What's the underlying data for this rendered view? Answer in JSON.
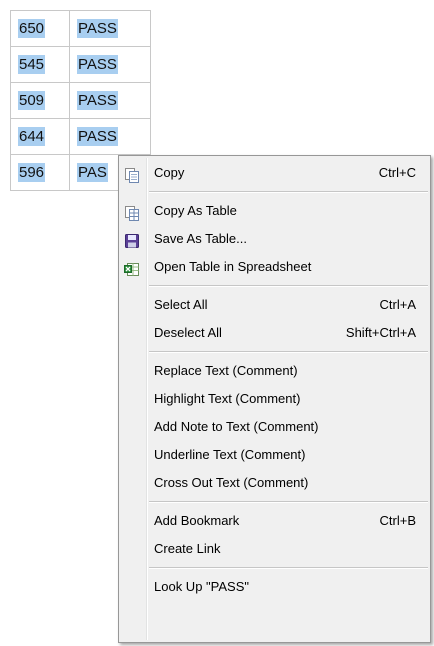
{
  "table": {
    "rows": [
      {
        "id": "650",
        "status": "PASS"
      },
      {
        "id": "545",
        "status": "PASS"
      },
      {
        "id": "509",
        "status": "PASS"
      },
      {
        "id": "644",
        "status": "PASS"
      },
      {
        "id": "596",
        "status": "PAS"
      }
    ],
    "selection_color": "#a8cef0"
  },
  "menu": {
    "copy": {
      "label": "Copy",
      "shortcut": "Ctrl+C",
      "icon": "copy-icon"
    },
    "copy_as_table": {
      "label": "Copy As Table",
      "icon": "copy-table-icon"
    },
    "save_as_table": {
      "label": "Save As Table...",
      "icon": "save-disk-icon"
    },
    "open_table_spreadsheet": {
      "label": "Open Table in Spreadsheet",
      "icon": "spreadsheet-icon"
    },
    "select_all": {
      "label": "Select All",
      "shortcut": "Ctrl+A"
    },
    "deselect_all": {
      "label": "Deselect All",
      "shortcut": "Shift+Ctrl+A"
    },
    "replace_text": {
      "label": "Replace Text (Comment)"
    },
    "highlight_text": {
      "label": "Highlight Text (Comment)"
    },
    "add_note": {
      "label": "Add Note to Text (Comment)"
    },
    "underline_text": {
      "label": "Underline Text (Comment)"
    },
    "cross_out_text": {
      "label": "Cross Out Text (Comment)"
    },
    "add_bookmark": {
      "label": "Add Bookmark",
      "shortcut": "Ctrl+B"
    },
    "create_link": {
      "label": "Create Link"
    },
    "look_up": {
      "label": "Look Up \"PASS\""
    }
  }
}
